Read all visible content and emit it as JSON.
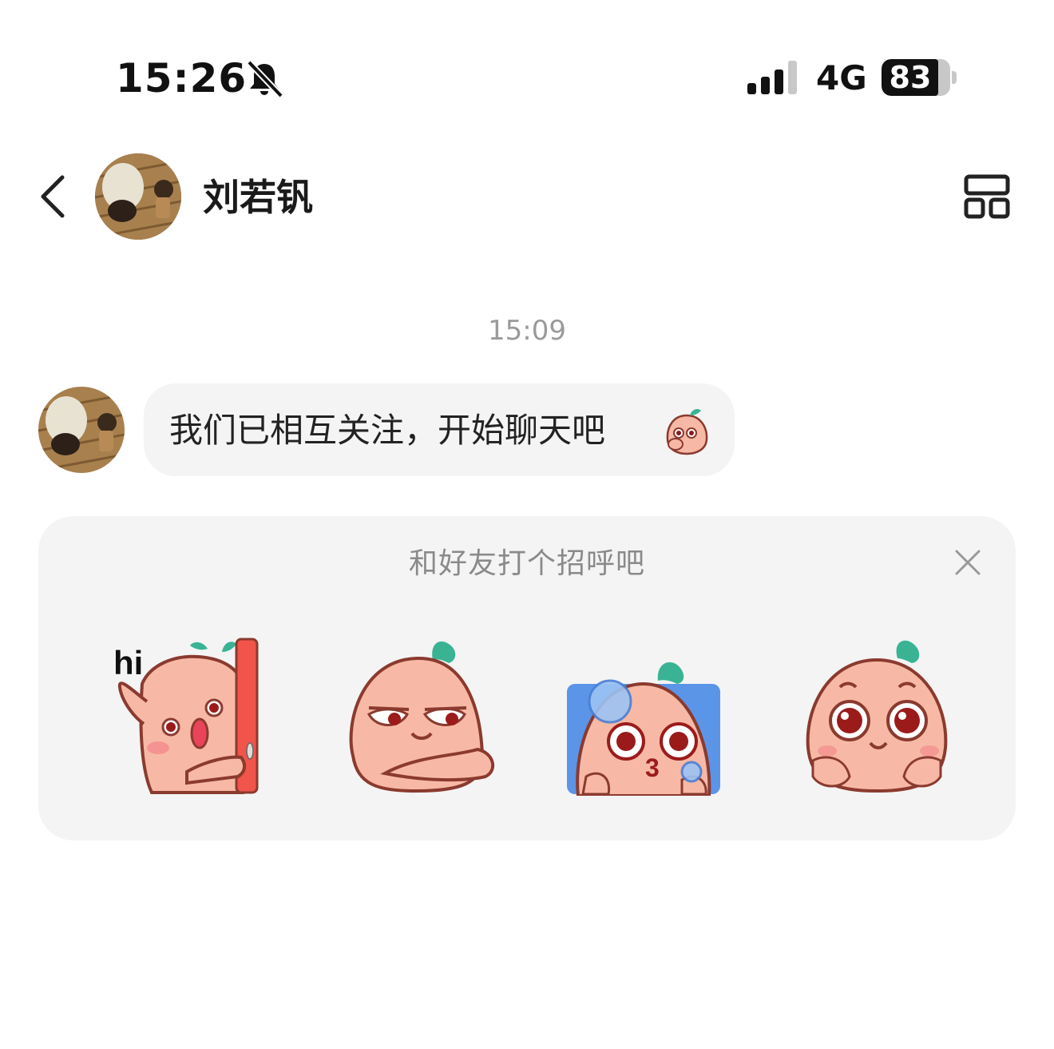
{
  "status_bar": {
    "time": "15:26",
    "network": "4G",
    "battery_level": 83,
    "battery_label": "83",
    "icons": [
      "bell-slash-icon",
      "signal-bars-icon"
    ]
  },
  "header": {
    "contact_name": "刘若钒",
    "icons": [
      "chevron-left-icon",
      "layout-grid-icon"
    ]
  },
  "chat": {
    "timestamp": "15:09",
    "message_text": "我们已相互关注，开始聊天吧"
  },
  "greeting_panel": {
    "title": "和好友打个招呼吧",
    "stickers": [
      {
        "name": "sticker-hi",
        "caption": "hi"
      },
      {
        "name": "sticker-smug"
      },
      {
        "name": "sticker-kiss"
      },
      {
        "name": "sticker-cute"
      }
    ]
  },
  "colors": {
    "bubble_bg": "#f4f4f4",
    "panel_bg": "#f4f4f4",
    "peach_skin": "#f7b9a5",
    "peach_outline": "#8b3a2f",
    "leaf": "#3ab394",
    "door_red": "#f0544a"
  }
}
